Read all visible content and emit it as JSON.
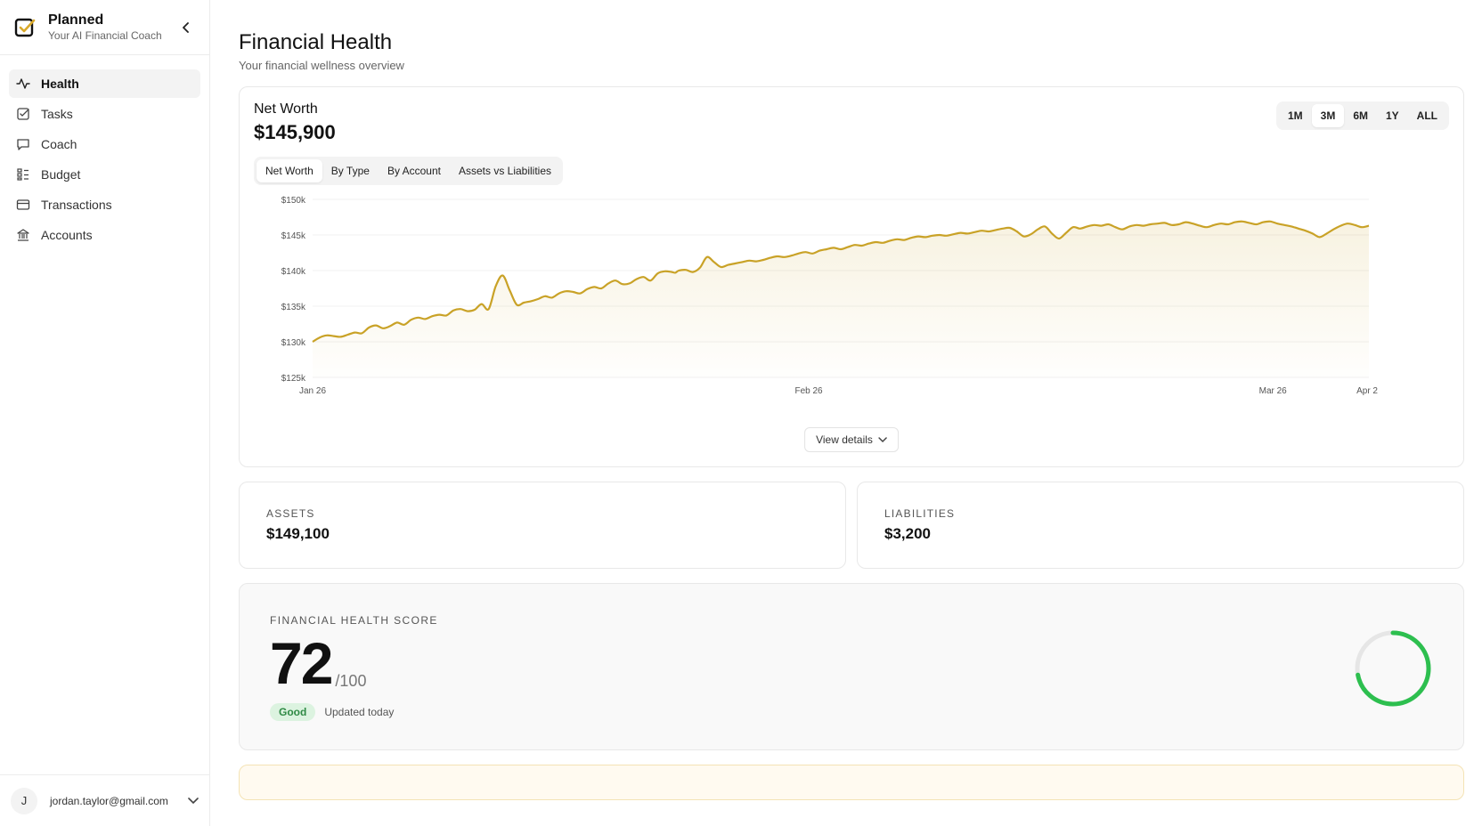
{
  "brand": {
    "name": "Planned",
    "subtitle": "Your AI Financial Coach"
  },
  "nav": [
    {
      "label": "Health",
      "icon": "activity-icon",
      "active": true
    },
    {
      "label": "Tasks",
      "icon": "checkbox-icon"
    },
    {
      "label": "Coach",
      "icon": "chat-icon"
    },
    {
      "label": "Budget",
      "icon": "grid-list-icon"
    },
    {
      "label": "Transactions",
      "icon": "card-icon"
    },
    {
      "label": "Accounts",
      "icon": "bank-icon"
    }
  ],
  "user": {
    "initial": "J",
    "email": "jordan.taylor@gmail.com"
  },
  "page": {
    "title": "Financial Health",
    "subtitle": "Your financial wellness overview"
  },
  "net_worth": {
    "label": "Net Worth",
    "value": "$145,900",
    "ranges": [
      "1M",
      "3M",
      "6M",
      "1Y",
      "ALL"
    ],
    "active_range": "3M",
    "tabs": [
      "Net Worth",
      "By Type",
      "By Account",
      "Assets vs Liabilities"
    ],
    "active_tab": "Net Worth",
    "view_details": "View details"
  },
  "chart_data": {
    "type": "area",
    "title": "",
    "xlabel": "",
    "ylabel": "",
    "ylim": [
      125,
      150
    ],
    "y_ticks": [
      "$150k",
      "$145k",
      "$140k",
      "$135k",
      "$130k",
      "$125k"
    ],
    "x_ticks": [
      "Jan 26",
      "Feb 26",
      "Mar 26",
      "Apr 2"
    ],
    "grid": true,
    "color": "#c9a227",
    "x": [
      0,
      2,
      4,
      6,
      8,
      10,
      12,
      14,
      16,
      18,
      20,
      22,
      24,
      26,
      28,
      30,
      32,
      34,
      36,
      38,
      40,
      42,
      44,
      46,
      48,
      50,
      52,
      54,
      56,
      58,
      60,
      62,
      64,
      66,
      68,
      70,
      72,
      74,
      76,
      78,
      80,
      82,
      84,
      86,
      88,
      90,
      92,
      94,
      96,
      98,
      100,
      102,
      103,
      104,
      106,
      108,
      110,
      112,
      114,
      116,
      118,
      120,
      122,
      124,
      126,
      128,
      130,
      132,
      134,
      136,
      138,
      140,
      142,
      144,
      146,
      148,
      150,
      152,
      154,
      156,
      158,
      160,
      162,
      164,
      166,
      168,
      170,
      172,
      174,
      176,
      178,
      180,
      182,
      184,
      186,
      188,
      190,
      192,
      194,
      196,
      198,
      200,
      202,
      204,
      206,
      208,
      210,
      212,
      214,
      216,
      218,
      220,
      222,
      224,
      226,
      228,
      230,
      232,
      234,
      236,
      238,
      240,
      242,
      244,
      246,
      248,
      250,
      252,
      254,
      256,
      258,
      260,
      262,
      264,
      266,
      268,
      270,
      272,
      274,
      276,
      278,
      280,
      282,
      284,
      286,
      288,
      290,
      292,
      294,
      296,
      298,
      300
    ],
    "values": [
      130,
      130.6,
      130.9,
      130.8,
      130.7,
      131,
      131.3,
      131.2,
      132,
      132.3,
      131.9,
      132.2,
      132.7,
      132.4,
      133.1,
      133.4,
      133.2,
      133.6,
      133.8,
      133.7,
      134.4,
      134.6,
      134.3,
      134.5,
      135.3,
      134.6,
      137.8,
      139.3,
      137.2,
      135.2,
      135.5,
      135.7,
      136,
      136.4,
      136.2,
      136.8,
      137.1,
      137,
      136.8,
      137.4,
      137.7,
      137.5,
      138.2,
      138.6,
      138.1,
      138.2,
      138.8,
      139.1,
      138.6,
      139.6,
      139.9,
      139.8,
      139.7,
      140,
      140.1,
      139.8,
      140.4,
      141.9,
      141.2,
      140.5,
      140.8,
      141,
      141.2,
      141.4,
      141.3,
      141.5,
      141.8,
      142,
      141.9,
      142.1,
      142.4,
      142.6,
      142.4,
      142.8,
      143,
      143.2,
      143,
      143.3,
      143.6,
      143.5,
      143.8,
      144,
      143.9,
      144.2,
      144.4,
      144.3,
      144.6,
      144.8,
      144.7,
      144.9,
      145,
      144.9,
      145.1,
      145.3,
      145.2,
      145.4,
      145.6,
      145.5,
      145.7,
      145.9,
      146,
      145.5,
      144.8,
      145.1,
      145.8,
      146.2,
      145.2,
      144.5,
      145.3,
      146.1,
      145.9,
      146.2,
      146.4,
      146.3,
      146.5,
      146.1,
      145.8,
      146.2,
      146.4,
      146.3,
      146.5,
      146.6,
      146.7,
      146.4,
      146.5,
      146.8,
      146.6,
      146.3,
      146.1,
      146.4,
      146.6,
      146.5,
      146.8,
      146.9,
      146.7,
      146.5,
      146.8,
      146.9,
      146.6,
      146.4,
      146.2,
      145.9,
      145.6,
      145.2,
      144.7,
      145.2,
      145.8,
      146.3,
      146.6,
      146.4,
      146.1,
      146.3,
      146.6,
      146.9,
      146.4
    ]
  },
  "assets": {
    "label": "ASSETS",
    "value": "$149,100"
  },
  "liabilities": {
    "label": "LIABILITIES",
    "value": "$3,200"
  },
  "score": {
    "label": "FINANCIAL HEALTH SCORE",
    "value": "72",
    "max": "/100",
    "score_fraction": 0.72,
    "badge": "Good",
    "updated": "Updated today",
    "gauge_color": "#2dbf4f"
  }
}
